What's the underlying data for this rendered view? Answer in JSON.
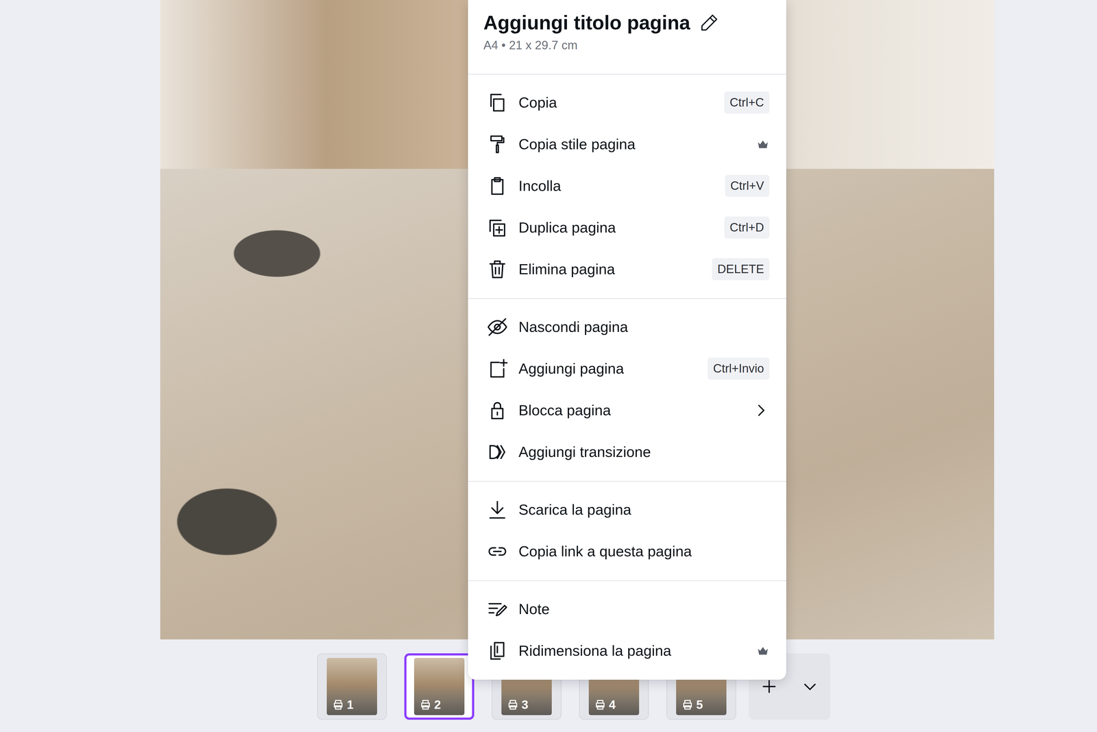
{
  "menu": {
    "title": "Aggiungi titolo pagina",
    "subtitle": "A4 • 21 x 29.7 cm",
    "groups": [
      {
        "items": [
          {
            "label": "Copia",
            "kind": "shortcut",
            "shortcut": "Ctrl+C"
          },
          {
            "label": "Copia stile pagina",
            "kind": "pro"
          },
          {
            "label": "Incolla",
            "kind": "shortcut",
            "shortcut": "Ctrl+V"
          },
          {
            "label": "Duplica pagina",
            "kind": "shortcut",
            "shortcut": "Ctrl+D"
          },
          {
            "label": "Elimina pagina",
            "kind": "shortcut",
            "shortcut": "DELETE"
          }
        ]
      },
      {
        "items": [
          {
            "label": "Nascondi pagina",
            "kind": "plain"
          },
          {
            "label": "Aggiungi pagina",
            "kind": "shortcut",
            "shortcut": "Ctrl+Invio"
          },
          {
            "label": "Blocca pagina",
            "kind": "submenu"
          },
          {
            "label": "Aggiungi transizione",
            "kind": "plain"
          }
        ]
      },
      {
        "items": [
          {
            "label": "Scarica la pagina",
            "kind": "plain"
          },
          {
            "label": "Copia link a questa pagina",
            "kind": "plain"
          }
        ]
      },
      {
        "items": [
          {
            "label": "Note",
            "kind": "plain"
          },
          {
            "label": "Ridimensiona la pagina",
            "kind": "pro"
          }
        ]
      }
    ]
  },
  "pages": [
    {
      "number": "1",
      "selected": false
    },
    {
      "number": "2",
      "selected": true
    },
    {
      "number": "3",
      "selected": false
    },
    {
      "number": "4",
      "selected": false
    },
    {
      "number": "5",
      "selected": false
    }
  ]
}
